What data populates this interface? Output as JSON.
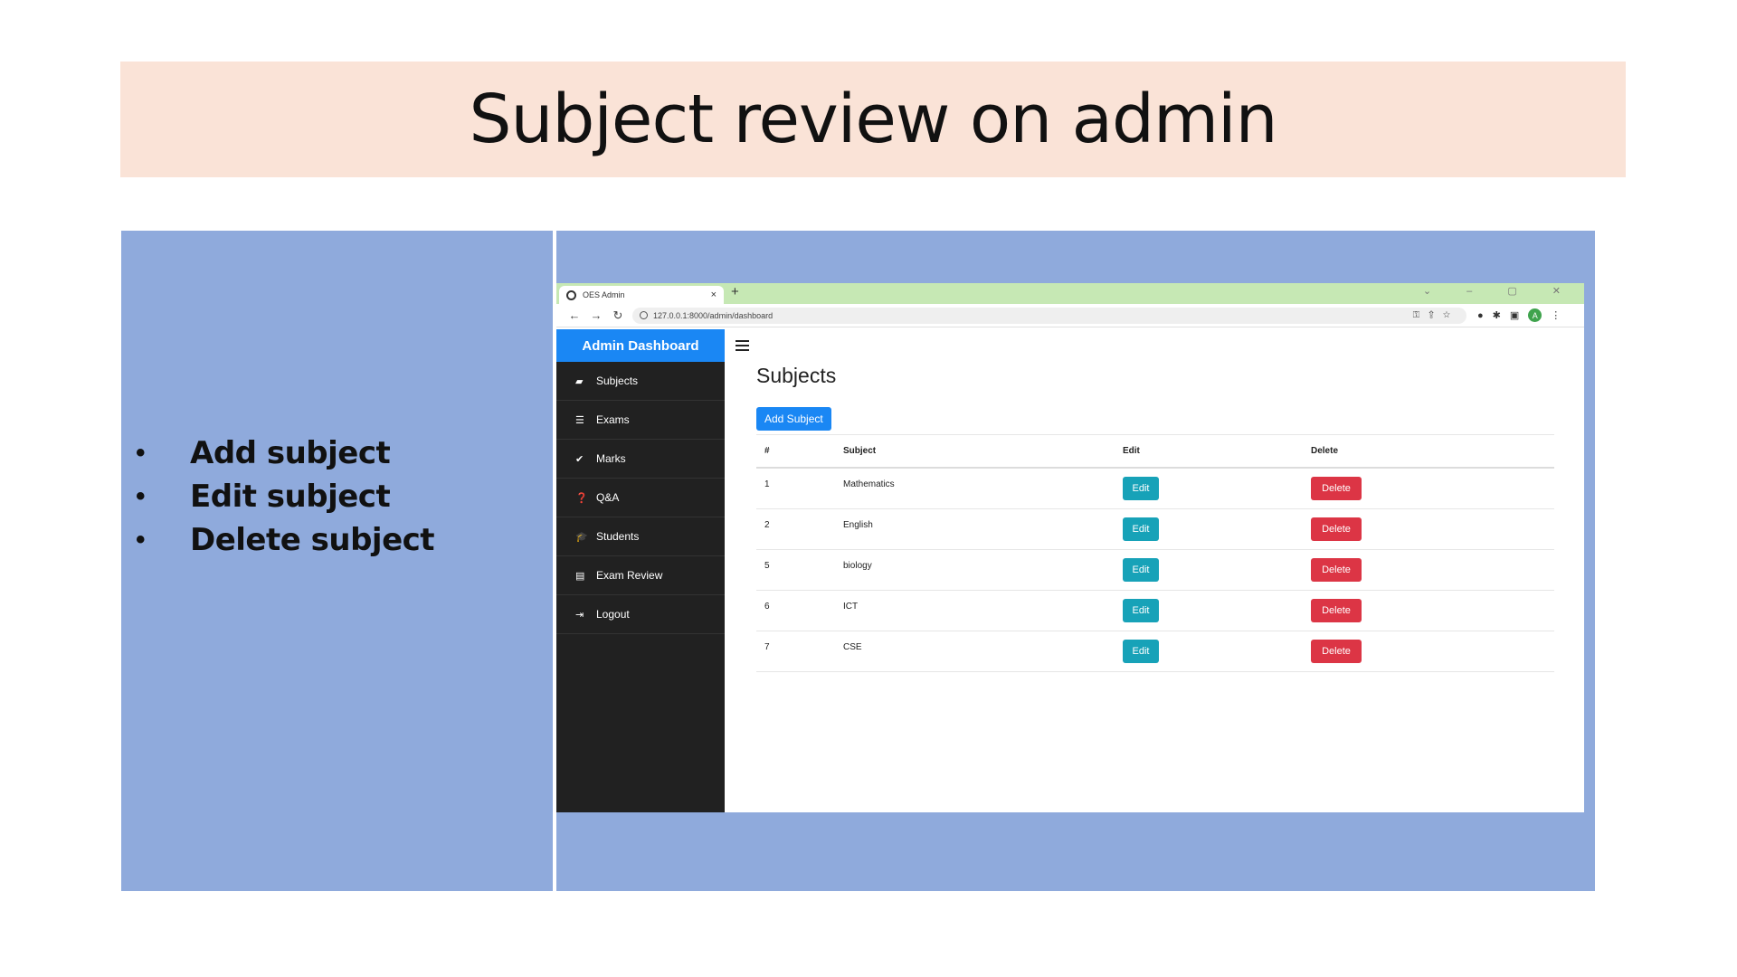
{
  "slide": {
    "title": "Subject review on admin",
    "bullets": [
      "Add subject",
      "Edit subject",
      "Delete subject"
    ]
  },
  "browser": {
    "tab_title": "OES Admin",
    "tab_close": "×",
    "new_tab": "+",
    "window_controls": "⌄ – ▢ ✕",
    "url": "127.0.0.1:8000/admin/dashboard",
    "avatar_letter": "A"
  },
  "sidebar": {
    "brand": "Admin Dashboard",
    "items": [
      {
        "label": "Subjects",
        "icon": "book-icon"
      },
      {
        "label": "Exams",
        "icon": "list-icon"
      },
      {
        "label": "Marks",
        "icon": "check-icon"
      },
      {
        "label": "Q&A",
        "icon": "question-circle-icon"
      },
      {
        "label": "Students",
        "icon": "graduation-cap-icon"
      },
      {
        "label": "Exam Review",
        "icon": "document-icon"
      },
      {
        "label": "Logout",
        "icon": "sign-out-icon"
      }
    ]
  },
  "main": {
    "title": "Subjects",
    "add_button": "Add Subject",
    "table": {
      "headers": [
        "#",
        "Subject",
        "Edit",
        "Delete"
      ],
      "rows": [
        {
          "id": "1",
          "subject": "Mathematics",
          "edit": "Edit",
          "delete": "Delete"
        },
        {
          "id": "2",
          "subject": "English",
          "edit": "Edit",
          "delete": "Delete"
        },
        {
          "id": "5",
          "subject": "biology",
          "edit": "Edit",
          "delete": "Delete"
        },
        {
          "id": "6",
          "subject": "ICT",
          "edit": "Edit",
          "delete": "Delete"
        },
        {
          "id": "7",
          "subject": "CSE",
          "edit": "Edit",
          "delete": "Delete"
        }
      ]
    }
  },
  "colors": {
    "title_band": "#fae3d7",
    "panel_blue": "#8faadc",
    "primary": "#1a87f4",
    "edit": "#17a2b8",
    "delete": "#dc3545",
    "sidebar": "#212121",
    "tabbar": "#c6e8b4"
  }
}
